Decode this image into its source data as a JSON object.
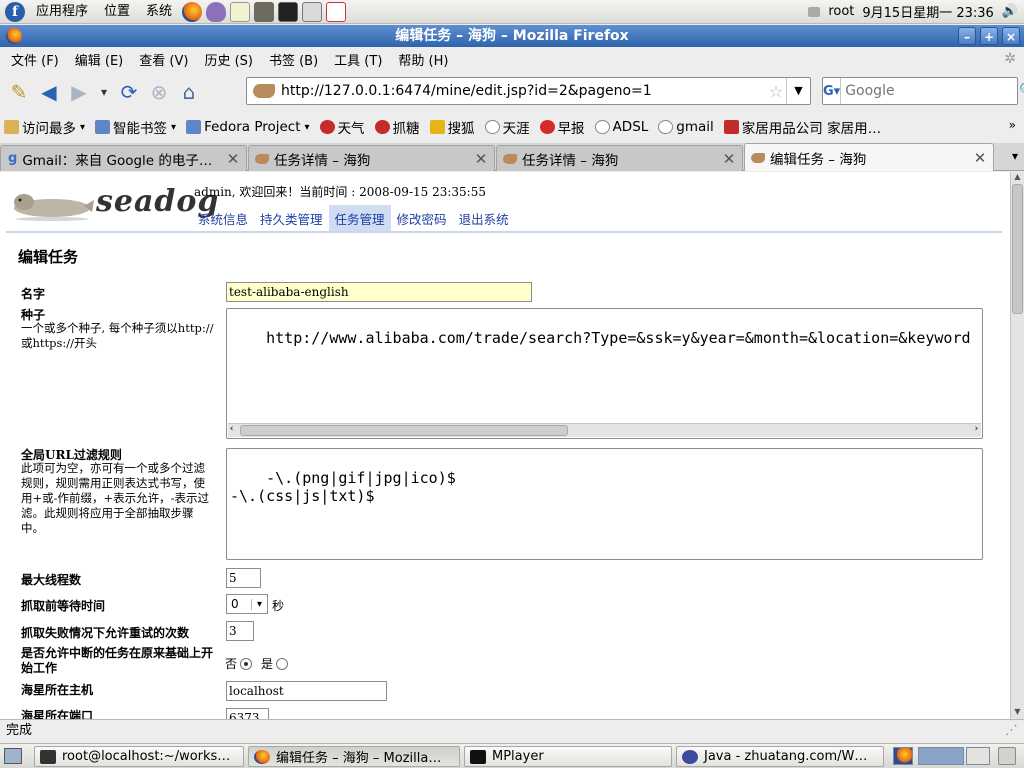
{
  "top_panel": {
    "menus": [
      "应用程序",
      "位置",
      "系统"
    ],
    "user": "root",
    "clock": "9月15日星期一 23:36"
  },
  "window": {
    "title": "编辑任务 – 海狗 – Mozilla Firefox"
  },
  "menubar": [
    "文件 (F)",
    "编辑 (E)",
    "查看 (V)",
    "历史 (S)",
    "书签 (B)",
    "工具 (T)",
    "帮助 (H)"
  ],
  "navbar": {
    "url": "http://127.0.0.1:6474/mine/edit.jsp?id=2&pageno=1",
    "search_placeholder": "Google",
    "search_engine": "G"
  },
  "bookmarks": [
    {
      "label": "访问最多",
      "icon": "folder-icon",
      "dropdown": true
    },
    {
      "label": "智能书签",
      "icon": "folder-icon",
      "dropdown": true
    },
    {
      "label": "Fedora Project",
      "icon": "folder-icon",
      "dropdown": true
    },
    {
      "label": "天气",
      "icon": "weather-icon",
      "dropdown": false
    },
    {
      "label": "抓糖",
      "icon": "site-icon",
      "dropdown": false
    },
    {
      "label": "搜狐",
      "icon": "site-icon",
      "dropdown": false
    },
    {
      "label": "天涯",
      "icon": "site-icon",
      "dropdown": false
    },
    {
      "label": "早报",
      "icon": "site-icon",
      "dropdown": false
    },
    {
      "label": "ADSL",
      "icon": "site-icon",
      "dropdown": false
    },
    {
      "label": "gmail",
      "icon": "site-icon",
      "dropdown": false
    },
    {
      "label": "家居用品公司 家居用…",
      "icon": "site-icon",
      "dropdown": false
    }
  ],
  "tabs": [
    {
      "label": "Gmail：来自 Google 的电子…",
      "active": false
    },
    {
      "label": "任务详情 – 海狗",
      "active": false
    },
    {
      "label": "任务详情 – 海狗",
      "active": false
    },
    {
      "label": "编辑任务 – 海狗",
      "active": true
    }
  ],
  "page": {
    "logo_text": "seadog",
    "welcome": "admin, 欢迎回来！当前时间 : 2008-09-15 23:35:55",
    "nav": [
      "系统信息",
      "持久类管理",
      "任务管理",
      "修改密码",
      "退出系统"
    ],
    "nav_active_index": 2,
    "heading": "编辑任务",
    "fields": {
      "name_label": "名字",
      "name_value": "test-alibaba-english",
      "seed_label": "种子",
      "seed_desc": "一个或多个种子, 每个种子须以http://或https://开头",
      "seed_value": "http://www.alibaba.com/trade/search?Type=&ssk=y&year=&month=&location=&keyword",
      "filter_label": "全局URL过滤规则",
      "filter_desc": "此项可为空，亦可有一个或多个过滤规则，规则需用正则表达式书写，使用+或-作前缀，+表示允许，-表示过滤。此规则将应用于全部抽取步骤中。",
      "filter_value": "-\\.(png|gif|jpg|ico)$\n-\\.(css|js|txt)$",
      "threads_label": "最大线程数",
      "threads_value": "5",
      "wait_label": "抓取前等待时间",
      "wait_value": "0",
      "wait_unit": "秒",
      "retries_label": "抓取失败情况下允许重试的次数",
      "retries_value": "3",
      "resume_label": "是否允许中断的任务在原来基础上开始工作",
      "resume_no": "否",
      "resume_yes": "是",
      "resume_selected": "否",
      "host_label": "海星所在主机",
      "host_value": "localhost",
      "port_label": "海星所在端口",
      "port_value": "6373"
    }
  },
  "statusbar": {
    "text": "完成"
  },
  "taskbar": [
    {
      "label": "root@localhost:~/works…",
      "active": false
    },
    {
      "label": "编辑任务 – 海狗 – Mozilla…",
      "active": true
    },
    {
      "label": "MPlayer",
      "active": false
    },
    {
      "label": "Java - zhuatang.com/W…",
      "active": false
    }
  ],
  "colors": {
    "titlebar": "#3b70b8",
    "link": "#1f3fa5",
    "name_input_bg": "#ffffcc",
    "nav_active_bg": "#cfdcf2"
  }
}
